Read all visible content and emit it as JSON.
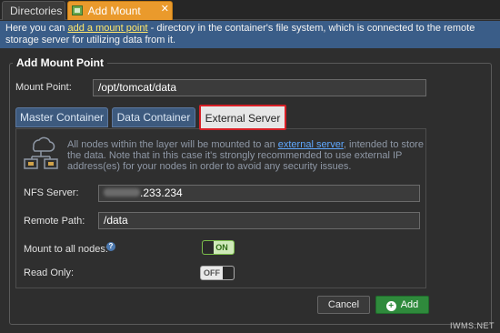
{
  "tabs": {
    "directories": "Directories",
    "add_mount_point": "Add Mount Point",
    "close": "✕"
  },
  "banner": {
    "prefix": "Here you can ",
    "link": "add a mount point",
    "suffix": " - directory in the container's file system, which is connected to the remote storage server for utilizing data from it."
  },
  "form": {
    "legend": "Add Mount Point",
    "mount_point_label": "Mount Point:",
    "mount_point_value": "/opt/tomcat/data",
    "source_tabs": [
      "Master Container",
      "Data Container",
      "External Server"
    ],
    "active_source_tab": "External Server",
    "description_prefix": "All nodes within the layer will be mounted to an ",
    "description_link": "external server",
    "description_suffix": ", intended to store the data. Note that in this case it's strongly recommended to use external IP address(es) for your nodes in order to avoid any security issues.",
    "nfs_server_label": "NFS Server:",
    "nfs_server_value": ".233.234",
    "remote_path_label": "Remote Path:",
    "remote_path_value": "/data",
    "mount_all_label": "Mount to all nodes:",
    "mount_all_state": "ON",
    "read_only_label": "Read Only:",
    "read_only_state": "OFF",
    "help": "?"
  },
  "buttons": {
    "cancel": "Cancel",
    "add": "Add"
  },
  "watermark": "IWMS.NET",
  "colors": {
    "active_tab": "#ea9a2c",
    "banner": "#3a5d88",
    "highlight_border": "#d71f26",
    "add_button": "#2f8a3c"
  }
}
